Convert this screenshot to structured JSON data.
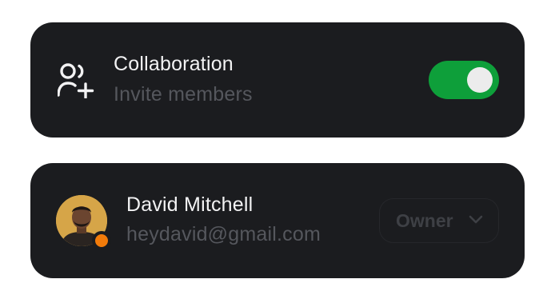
{
  "collaboration": {
    "title": "Collaboration",
    "subtitle": "Invite members",
    "icon": "user-plus-icon",
    "toggle_on": true,
    "toggle_color": "#0e9f3a"
  },
  "member": {
    "name": "David Mitchell",
    "email": "heydavid@gmail.com",
    "status_color": "#f27b0a",
    "role": {
      "selected": "Owner",
      "icon": "chevron-down-icon"
    }
  },
  "colors": {
    "card_background": "#1b1c1f",
    "title_text": "#f2f2f3",
    "muted_text": "#55575d"
  }
}
